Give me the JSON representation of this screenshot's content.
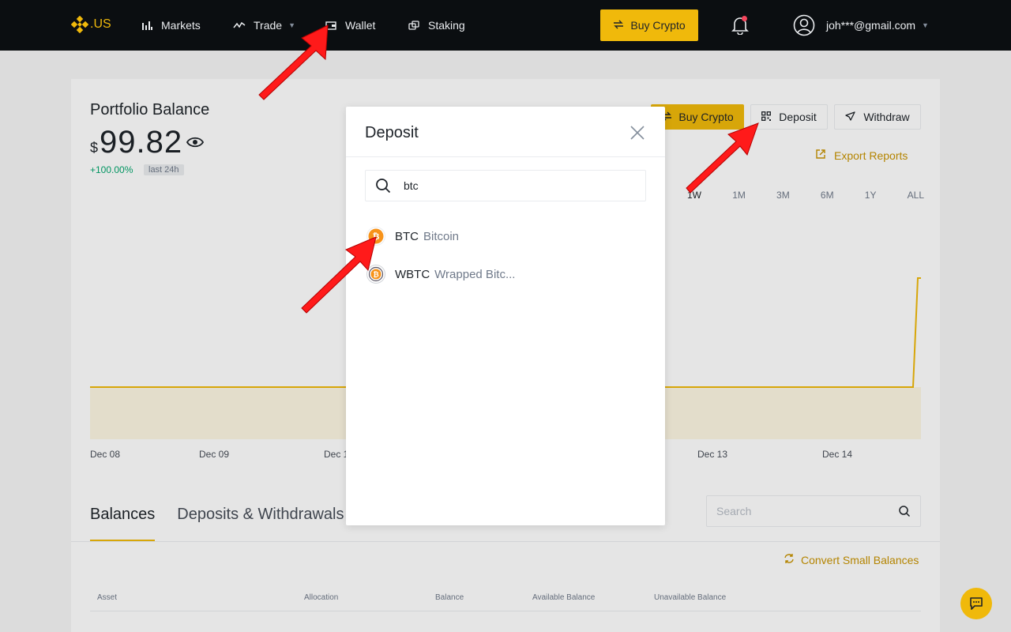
{
  "nav": {
    "logo_text": ".US",
    "items": [
      {
        "label": "Markets",
        "icon": "bar-chart-icon"
      },
      {
        "label": "Trade",
        "icon": "trend-icon"
      },
      {
        "label": "Wallet",
        "icon": "wallet-icon"
      },
      {
        "label": "Staking",
        "icon": "coins-icon"
      }
    ],
    "buy_crypto": "Buy Crypto",
    "user_email": "joh***@gmail.com"
  },
  "portfolio": {
    "title": "Portfolio Balance",
    "currency_symbol": "$",
    "value": "99.82",
    "change": "+100.00%",
    "period_badge": "last 24h",
    "buttons": {
      "buy": "Buy Crypto",
      "deposit": "Deposit",
      "withdraw": "Withdraw"
    },
    "export": "Export Reports",
    "ranges": [
      "1W",
      "1M",
      "3M",
      "6M",
      "1Y",
      "ALL"
    ],
    "active_range": "1W",
    "x_ticks": [
      "Dec 08",
      "Dec 09",
      "Dec 1",
      "Dec 13",
      "Dec 14"
    ]
  },
  "balances": {
    "tabs": [
      "Balances",
      "Deposits & Withdrawals"
    ],
    "search_placeholder": "Search",
    "convert": "Convert Small Balances",
    "columns": [
      "Asset",
      "Allocation",
      "Balance",
      "Available Balance",
      "Unavailable Balance"
    ]
  },
  "modal": {
    "title": "Deposit",
    "search_value": "btc",
    "results": [
      {
        "symbol": "BTC",
        "name": "Bitcoin"
      },
      {
        "symbol": "WBTC",
        "name": "Wrapped Bitc..."
      }
    ]
  },
  "colors": {
    "brand": "#f0b90b",
    "topbar": "#0b0e11",
    "positive": "#03a66d",
    "annotation_arrow": "#ff1a1a"
  }
}
